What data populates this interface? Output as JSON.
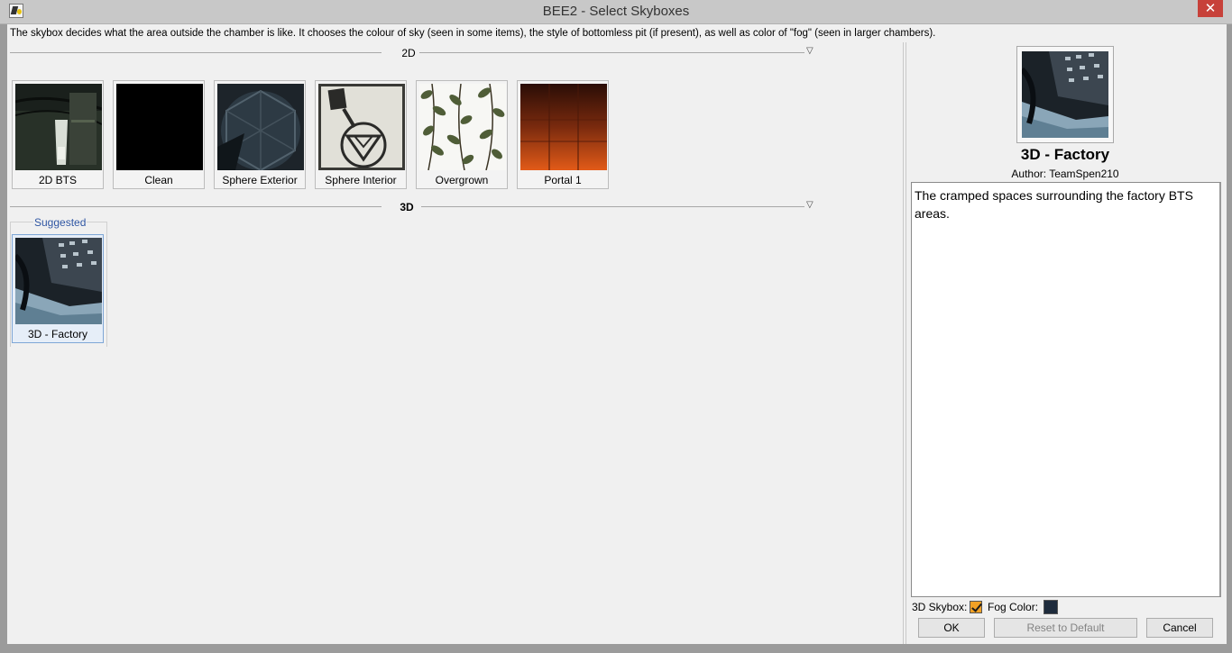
{
  "window": {
    "title": "BEE2 - Select Skyboxes",
    "close_glyph": "✕"
  },
  "description": "The skybox decides what the area outside the chamber is like. It chooses the colour of sky (seen in some items), the style of bottomless pit (if present), as well as color of \"fog\" (seen in larger chambers).",
  "groups": [
    {
      "title": "2D",
      "collapse_icon": "▽",
      "items": [
        {
          "label": "2D BTS",
          "thumb_icon": "bts-skybox-thumbnail"
        },
        {
          "label": "Clean",
          "thumb_icon": "clean-skybox-thumbnail"
        },
        {
          "label": "Sphere Exterior",
          "thumb_icon": "sphere-exterior-thumbnail"
        },
        {
          "label": "Sphere Interior",
          "thumb_icon": "sphere-interior-thumbnail"
        },
        {
          "label": "Overgrown",
          "thumb_icon": "overgrown-thumbnail"
        },
        {
          "label": "Portal 1",
          "thumb_icon": "portal1-thumbnail"
        }
      ]
    },
    {
      "title": "3D",
      "collapse_icon": "▽",
      "suggested_label": "Suggested",
      "items": [
        {
          "label": "3D - Factory",
          "thumb_icon": "factory-thumbnail",
          "selected": true
        }
      ]
    }
  ],
  "preview": {
    "title": "3D - Factory",
    "author": "Author: TeamSpen210",
    "description": "The cramped spaces surrounding the factory BTS areas.",
    "options": {
      "skybox_label": "3D Skybox:",
      "skybox_checked": true,
      "fog_label": "Fog Color:",
      "fog_color": "#1e2b3c"
    }
  },
  "buttons": {
    "ok": "OK",
    "reset": "Reset to Default",
    "cancel": "Cancel"
  },
  "colors": {
    "accent_checkbox": "#f2a125",
    "selected_border": "#7ea6d6",
    "close_button": "#c7413a"
  }
}
